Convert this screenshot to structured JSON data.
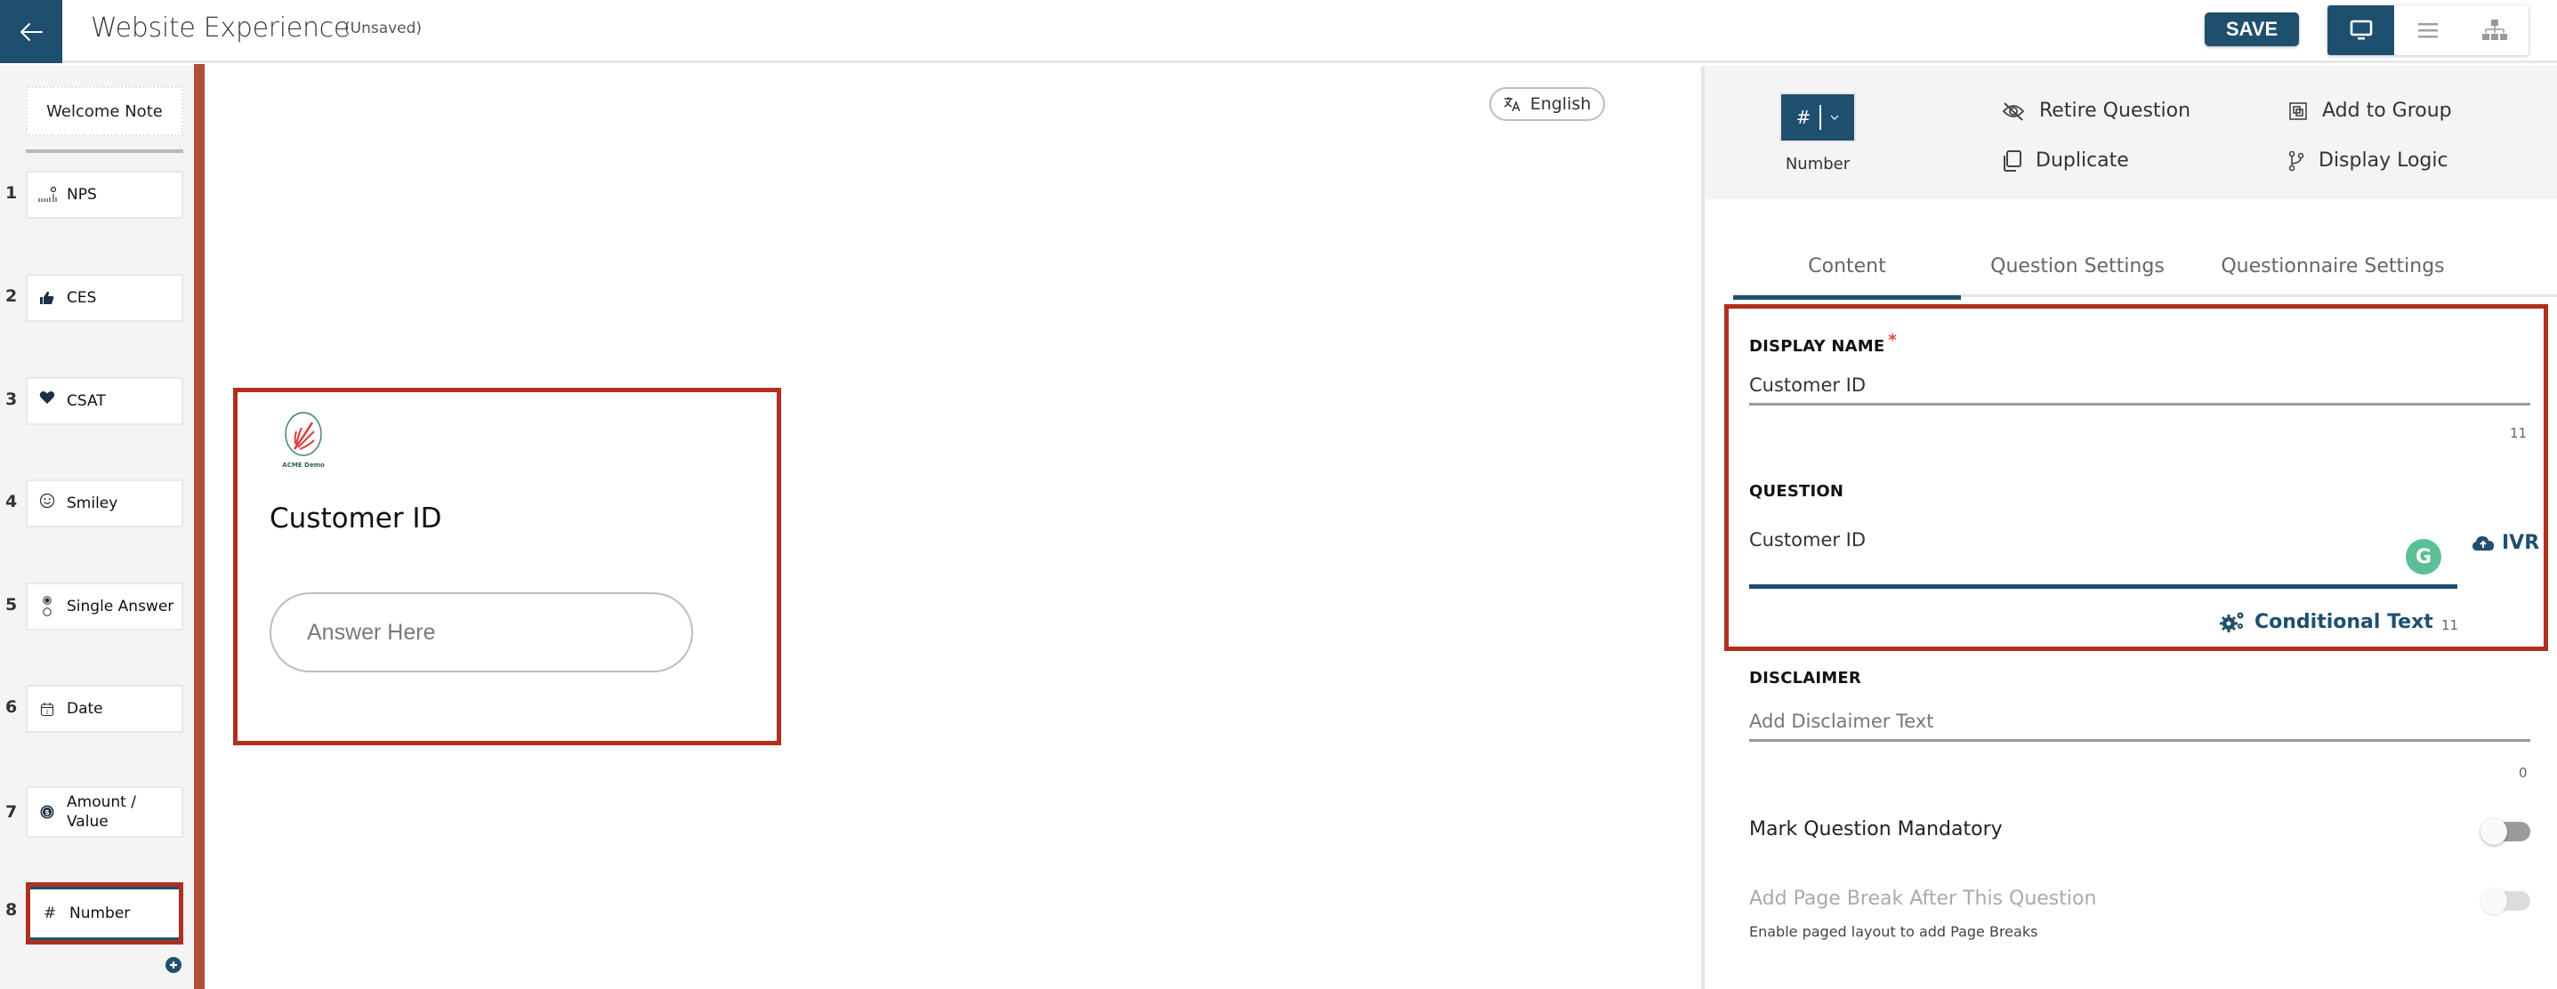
{
  "header": {
    "title": "Website Experience",
    "status": "(Unsaved)",
    "save_label": "SAVE",
    "view_modes": [
      {
        "name": "desktop-view",
        "icon": "monitor-icon",
        "active": true
      },
      {
        "name": "list-view",
        "icon": "list-icon",
        "active": false
      },
      {
        "name": "tree-view",
        "icon": "sitemap-icon",
        "active": false
      }
    ]
  },
  "sidebar": {
    "welcome_label": "Welcome Note",
    "questions": [
      {
        "num": "1",
        "label": "NPS",
        "icon": "nps-scale-icon"
      },
      {
        "num": "2",
        "label": "CES",
        "icon": "thumbs-up-icon"
      },
      {
        "num": "3",
        "label": "CSAT",
        "icon": "heart-icon"
      },
      {
        "num": "4",
        "label": "Smiley",
        "icon": "smiley-icon"
      },
      {
        "num": "5",
        "label": "Single Answer",
        "icon": "radio-icon"
      },
      {
        "num": "6",
        "label": "Date",
        "icon": "calendar-icon"
      },
      {
        "num": "7",
        "label": "Amount / Value",
        "icon": "dollar-icon"
      },
      {
        "num": "8",
        "label": "Number",
        "icon": "hash-icon",
        "selected": true
      }
    ],
    "add_icon": "add-circle-icon"
  },
  "canvas": {
    "language": "English",
    "logo_text": "ACME Demo",
    "question_title": "Customer ID",
    "answer_placeholder": "Answer Here"
  },
  "panel": {
    "type_symbol": "#",
    "type_label": "Number",
    "actions": {
      "retire": "Retire Question",
      "add_group": "Add to Group",
      "duplicate": "Duplicate",
      "display_logic": "Display Logic"
    },
    "tabs": [
      {
        "label": "Content",
        "active": true
      },
      {
        "label": "Question Settings",
        "active": false
      },
      {
        "label": "Questionnaire Settings",
        "active": false
      }
    ],
    "display_name": {
      "label": "DISPLAY NAME",
      "required_mark": "*",
      "value": "Customer ID",
      "count": "11"
    },
    "question": {
      "label": "QUESTION",
      "value": "Customer ID",
      "count": "11",
      "grammarly": "G",
      "ivr_label": "IVR",
      "conditional_label": "Conditional Text"
    },
    "disclaimer": {
      "label": "DISCLAIMER",
      "placeholder": "Add Disclaimer Text",
      "count": "0"
    },
    "mandatory": {
      "label": "Mark Question Mandatory",
      "on": false
    },
    "page_break": {
      "label": "Add Page Break After This Question",
      "on": false,
      "disabled": true,
      "hint": "Enable paged layout to add Page Breaks"
    }
  },
  "colors": {
    "primary": "#1f4f6e",
    "highlight": "#b0301f",
    "sidebar_accent": "#b34e38",
    "grammarly": "#5bc095"
  }
}
